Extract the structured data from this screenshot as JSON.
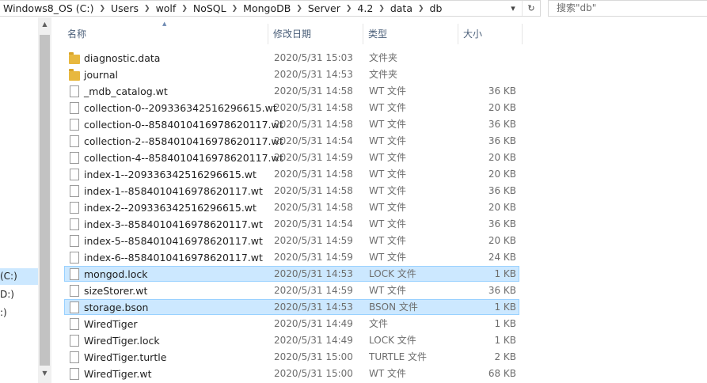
{
  "address": {
    "crumbs": [
      "Windows8_OS (C:)",
      "Users",
      "wolf",
      "NoSQL",
      "MongoDB",
      "Server",
      "4.2",
      "data",
      "db"
    ],
    "dropdown_glyph": "▾",
    "refresh_glyph": "↻"
  },
  "search": {
    "placeholder": "搜索\"db\""
  },
  "nav": {
    "items": [
      "(C:)",
      "D:)",
      ":)"
    ]
  },
  "columns": {
    "name": "名称",
    "date": "修改日期",
    "type": "类型",
    "size": "大小"
  },
  "files": [
    {
      "name": "diagnostic.data",
      "date": "2020/5/31 15:03",
      "type": "文件夹",
      "size": "",
      "kind": "folder"
    },
    {
      "name": "journal",
      "date": "2020/5/31 14:53",
      "type": "文件夹",
      "size": "",
      "kind": "folder"
    },
    {
      "name": "_mdb_catalog.wt",
      "date": "2020/5/31 14:58",
      "type": "WT 文件",
      "size": "36 KB",
      "kind": "file"
    },
    {
      "name": "collection-0--209336342516296615.wt",
      "date": "2020/5/31 14:58",
      "type": "WT 文件",
      "size": "20 KB",
      "kind": "file"
    },
    {
      "name": "collection-0--8584010416978620117.wt",
      "date": "2020/5/31 14:58",
      "type": "WT 文件",
      "size": "36 KB",
      "kind": "file"
    },
    {
      "name": "collection-2--8584010416978620117.wt",
      "date": "2020/5/31 14:54",
      "type": "WT 文件",
      "size": "36 KB",
      "kind": "file"
    },
    {
      "name": "collection-4--8584010416978620117.wt",
      "date": "2020/5/31 14:59",
      "type": "WT 文件",
      "size": "20 KB",
      "kind": "file"
    },
    {
      "name": "index-1--209336342516296615.wt",
      "date": "2020/5/31 14:58",
      "type": "WT 文件",
      "size": "20 KB",
      "kind": "file"
    },
    {
      "name": "index-1--8584010416978620117.wt",
      "date": "2020/5/31 14:58",
      "type": "WT 文件",
      "size": "36 KB",
      "kind": "file"
    },
    {
      "name": "index-2--209336342516296615.wt",
      "date": "2020/5/31 14:58",
      "type": "WT 文件",
      "size": "20 KB",
      "kind": "file"
    },
    {
      "name": "index-3--8584010416978620117.wt",
      "date": "2020/5/31 14:54",
      "type": "WT 文件",
      "size": "36 KB",
      "kind": "file"
    },
    {
      "name": "index-5--8584010416978620117.wt",
      "date": "2020/5/31 14:59",
      "type": "WT 文件",
      "size": "20 KB",
      "kind": "file"
    },
    {
      "name": "index-6--8584010416978620117.wt",
      "date": "2020/5/31 14:59",
      "type": "WT 文件",
      "size": "24 KB",
      "kind": "file"
    },
    {
      "name": "mongod.lock",
      "date": "2020/5/31 14:53",
      "type": "LOCK 文件",
      "size": "1 KB",
      "kind": "file",
      "selected": true
    },
    {
      "name": "sizeStorer.wt",
      "date": "2020/5/31 14:59",
      "type": "WT 文件",
      "size": "36 KB",
      "kind": "file"
    },
    {
      "name": "storage.bson",
      "date": "2020/5/31 14:53",
      "type": "BSON 文件",
      "size": "1 KB",
      "kind": "file",
      "selected": true
    },
    {
      "name": "WiredTiger",
      "date": "2020/5/31 14:49",
      "type": "文件",
      "size": "1 KB",
      "kind": "file"
    },
    {
      "name": "WiredTiger.lock",
      "date": "2020/5/31 14:49",
      "type": "LOCK 文件",
      "size": "1 KB",
      "kind": "file"
    },
    {
      "name": "WiredTiger.turtle",
      "date": "2020/5/31 15:00",
      "type": "TURTLE 文件",
      "size": "2 KB",
      "kind": "file"
    },
    {
      "name": "WiredTiger.wt",
      "date": "2020/5/31 15:00",
      "type": "WT 文件",
      "size": "68 KB",
      "kind": "file"
    }
  ]
}
